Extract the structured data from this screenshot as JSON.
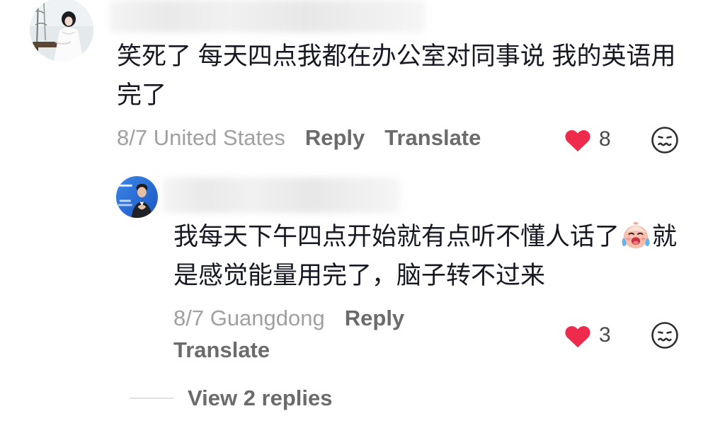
{
  "comment": {
    "avatar": "avatar-woman-with-guqin",
    "text": "笑死了 每天四点我都在办公室对同事说 我的英语用完了",
    "meta": "8/7 United States",
    "reply_label": "Reply",
    "translate_label": "Translate",
    "like_icon": "heart-icon",
    "likes": "8",
    "dislike_icon": "dislike-face-icon"
  },
  "reply": {
    "avatar": "avatar-man-heart-gesture",
    "text_before_emoji": "我每天下午四点开始就有点听不懂人话了",
    "emoji": "crying-peach-emoji",
    "text_after_emoji": "就是感觉能量用完了，脑子转不过来",
    "meta": "8/7 Guangdong",
    "reply_label": "Reply",
    "translate_label": "Translate",
    "like_icon": "heart-icon",
    "likes": "3",
    "dislike_icon": "dislike-face-icon"
  },
  "view_replies_label": "View 2 replies",
  "colors": {
    "text": "#161823",
    "meta": "#a0a0a0",
    "action": "#6b6b6b",
    "like": "#ee2b4d"
  }
}
